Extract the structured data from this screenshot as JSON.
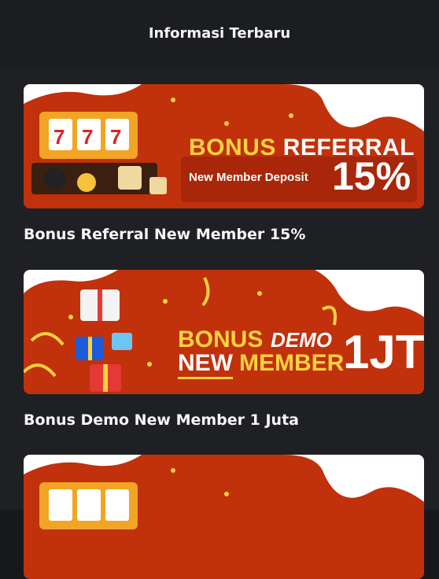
{
  "header": {
    "title": "Informasi Terbaru"
  },
  "posts": [
    {
      "caption": "Bonus Referral New Member 15%",
      "banner": {
        "word_bonus": "BONUS",
        "word_referral": "REFERRAL",
        "subline": "New Member Deposit",
        "percent": "15%"
      }
    },
    {
      "caption": "Bonus Demo New Member 1 Juta",
      "banner": {
        "word_bonus": "BONUS",
        "word_demo": "DEMO",
        "word_new": "NEW",
        "word_member": "MEMBER",
        "amount": "1JT"
      }
    },
    {
      "caption": "",
      "banner": {}
    }
  ],
  "colors": {
    "banner_red": "#c0310c",
    "banner_yellow": "#ffd23f",
    "page_bg": "#1f2024",
    "header_bg": "#1c1d21"
  }
}
